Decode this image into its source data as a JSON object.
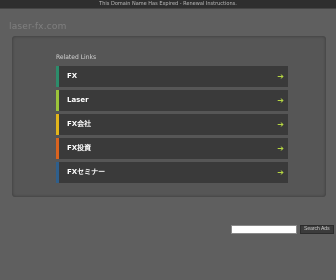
{
  "topbar": {
    "text": "This Domain Name Has Expired - Renewal Instructions."
  },
  "domain": {
    "name": "laser-fx.com"
  },
  "related": {
    "title": "Related Links",
    "links": [
      {
        "label": "FX",
        "arrow": "➔",
        "color": "#2c8c6b"
      },
      {
        "label": "Laser",
        "arrow": "➔",
        "color": "#9cc43a"
      },
      {
        "label": "FX会社",
        "arrow": "➔",
        "color": "#e2b51b"
      },
      {
        "label": "FX投資",
        "arrow": "➔",
        "color": "#d9631f"
      },
      {
        "label": "FXセミナー",
        "arrow": "➔",
        "color": "#2f5f8c"
      }
    ]
  },
  "search": {
    "placeholder": "",
    "button_label": "Search Ads"
  }
}
